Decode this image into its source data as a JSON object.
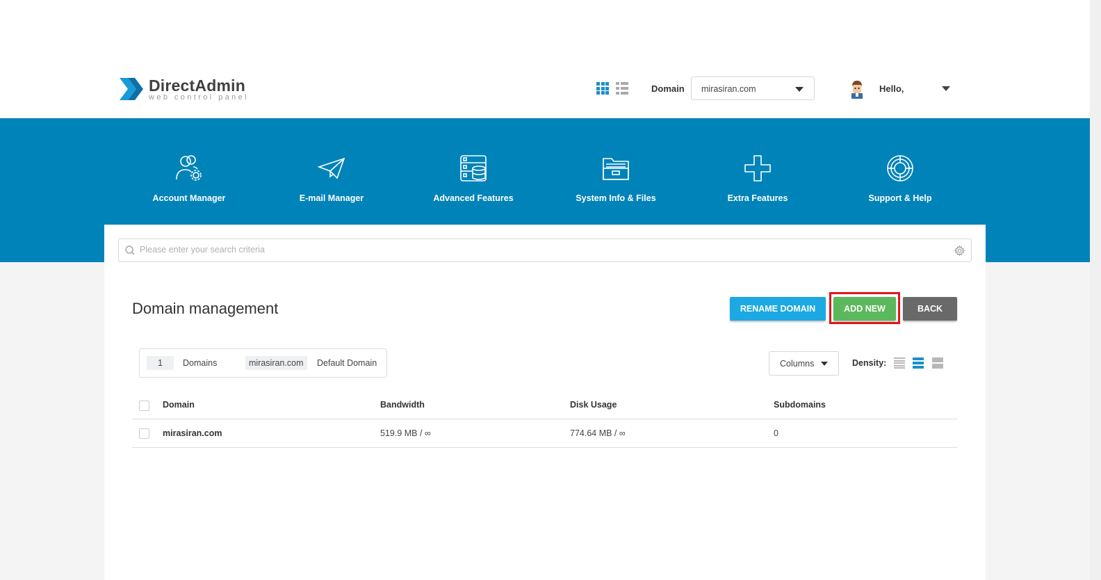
{
  "brand": {
    "title": "DirectAdmin",
    "subtitle": "web control panel"
  },
  "header": {
    "domain_label": "Domain",
    "domain_value": "mirasiran.com",
    "greeting": "Hello,"
  },
  "nav": {
    "items": [
      {
        "label": "Account Manager",
        "icon": "account-manager-icon"
      },
      {
        "label": "E-mail Manager",
        "icon": "paper-plane-icon"
      },
      {
        "label": "Advanced Features",
        "icon": "server-database-icon"
      },
      {
        "label": "System Info & Files",
        "icon": "folder-icon"
      },
      {
        "label": "Extra Features",
        "icon": "plus-icon"
      },
      {
        "label": "Support & Help",
        "icon": "lifebuoy-icon"
      }
    ]
  },
  "search": {
    "placeholder": "Please enter your search criteria"
  },
  "page": {
    "title": "Domain management"
  },
  "buttons": {
    "rename": "RENAME DOMAIN",
    "add_new": "ADD NEW",
    "back": "BACK"
  },
  "summary": {
    "count": "1",
    "count_label": "Domains",
    "default_domain": "mirasiran.com",
    "default_label": "Default Domain"
  },
  "toolbar": {
    "columns": "Columns",
    "density_label": "Density:"
  },
  "table": {
    "headers": [
      "Domain",
      "Bandwidth",
      "Disk Usage",
      "Subdomains"
    ],
    "rows": [
      {
        "domain": "mirasiran.com",
        "bandwidth": "519.9 MB / ∞",
        "disk_usage": "774.64 MB / ∞",
        "subdomains": "0"
      }
    ]
  },
  "colors": {
    "nav_bg": "#0083b9",
    "rename": "#1ba8e3",
    "add_new": "#5cb85c",
    "back": "#696969",
    "highlight": "#e3151a"
  }
}
